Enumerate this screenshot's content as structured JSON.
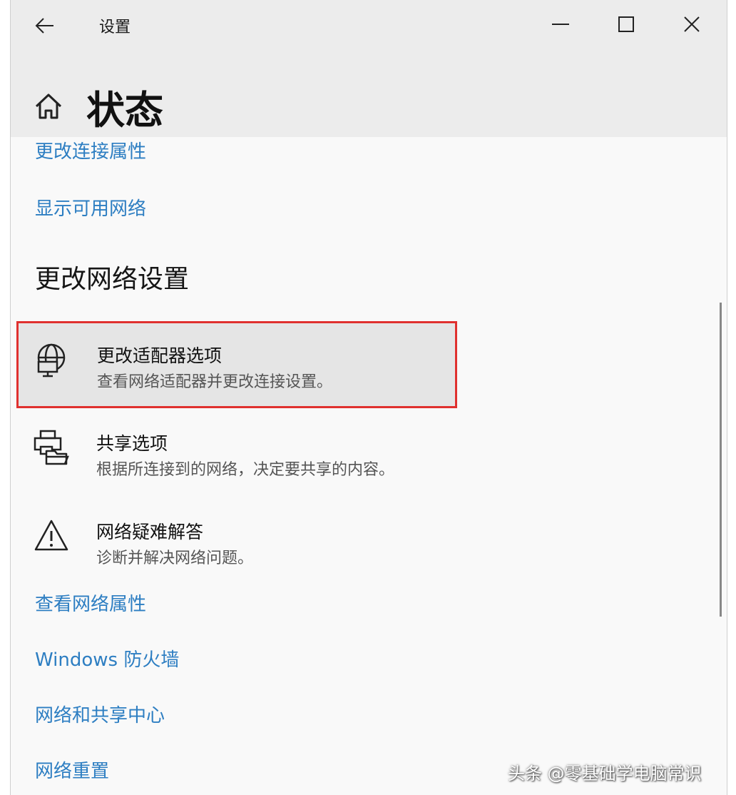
{
  "window": {
    "title": "设置",
    "controls": {
      "minimize": "minimize-icon",
      "maximize": "maximize-icon",
      "close": "close-icon"
    }
  },
  "header": {
    "page_title": "状态",
    "home_icon": "home-icon",
    "back_icon": "back-arrow-icon"
  },
  "links_top": [
    "更改连接属性",
    "显示可用网络"
  ],
  "section": {
    "heading": "更改网络设置"
  },
  "items": [
    {
      "title": "更改适配器选项",
      "desc": "查看网络适配器并更改连接设置。",
      "icon": "network-adapter-icon",
      "selected": true
    },
    {
      "title": "共享选项",
      "desc": "根据所连接到的网络，决定要共享的内容。",
      "icon": "sharing-icon",
      "selected": false
    },
    {
      "title": "网络疑难解答",
      "desc": "诊断并解决网络问题。",
      "icon": "warning-icon",
      "selected": false
    }
  ],
  "links_bottom": [
    "查看网络属性",
    "Windows 防火墙",
    "网络和共享中心",
    "网络重置"
  ],
  "watermark": "头条 @零基础学电脑常识",
  "colors": {
    "link": "#2d7ec2",
    "highlight_border": "#e0312f",
    "titlebar_bg": "#ececec",
    "content_bg": "#f9f9f9"
  }
}
